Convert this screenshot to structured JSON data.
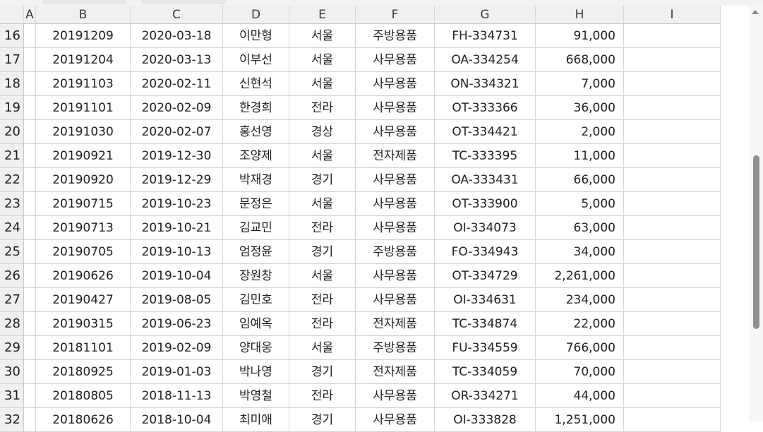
{
  "columns": [
    "A",
    "B",
    "C",
    "D",
    "E",
    "F",
    "G",
    "H",
    "I"
  ],
  "rows": [
    {
      "num": "16",
      "cells": [
        "",
        "20191209",
        "2020-03-18",
        "이만형",
        "서울",
        "주방용품",
        "FH-334731",
        "91,000",
        ""
      ]
    },
    {
      "num": "17",
      "cells": [
        "",
        "20191204",
        "2020-03-13",
        "이부선",
        "서울",
        "사무용품",
        "OA-334254",
        "668,000",
        ""
      ]
    },
    {
      "num": "18",
      "cells": [
        "",
        "20191103",
        "2020-02-11",
        "신현석",
        "서울",
        "사무용품",
        "ON-334321",
        "7,000",
        ""
      ]
    },
    {
      "num": "19",
      "cells": [
        "",
        "20191101",
        "2020-02-09",
        "한경희",
        "전라",
        "사무용품",
        "OT-333366",
        "36,000",
        ""
      ]
    },
    {
      "num": "20",
      "cells": [
        "",
        "20191030",
        "2020-02-07",
        "홍선영",
        "경상",
        "사무용품",
        "OT-334421",
        "2,000",
        ""
      ]
    },
    {
      "num": "21",
      "cells": [
        "",
        "20190921",
        "2019-12-30",
        "조양제",
        "서울",
        "전자제품",
        "TC-333395",
        "11,000",
        ""
      ]
    },
    {
      "num": "22",
      "cells": [
        "",
        "20190920",
        "2019-12-29",
        "박재경",
        "경기",
        "사무용품",
        "OA-333431",
        "66,000",
        ""
      ]
    },
    {
      "num": "23",
      "cells": [
        "",
        "20190715",
        "2019-10-23",
        "문정은",
        "서울",
        "사무용품",
        "OT-333900",
        "5,000",
        ""
      ]
    },
    {
      "num": "24",
      "cells": [
        "",
        "20190713",
        "2019-10-21",
        "김교민",
        "전라",
        "사무용품",
        "OI-334073",
        "63,000",
        ""
      ]
    },
    {
      "num": "25",
      "cells": [
        "",
        "20190705",
        "2019-10-13",
        "엄정윤",
        "경기",
        "주방용품",
        "FO-334943",
        "34,000",
        ""
      ]
    },
    {
      "num": "26",
      "cells": [
        "",
        "20190626",
        "2019-10-04",
        "장원창",
        "서울",
        "사무용품",
        "OT-334729",
        "2,261,000",
        ""
      ]
    },
    {
      "num": "27",
      "cells": [
        "",
        "20190427",
        "2019-08-05",
        "김민호",
        "전라",
        "사무용품",
        "OI-334631",
        "234,000",
        ""
      ]
    },
    {
      "num": "28",
      "cells": [
        "",
        "20190315",
        "2019-06-23",
        "임예옥",
        "전라",
        "전자제품",
        "TC-334874",
        "22,000",
        ""
      ]
    },
    {
      "num": "29",
      "cells": [
        "",
        "20181101",
        "2019-02-09",
        "양대웅",
        "서울",
        "주방용품",
        "FU-334559",
        "766,000",
        ""
      ]
    },
    {
      "num": "30",
      "cells": [
        "",
        "20180925",
        "2019-01-03",
        "박나영",
        "경기",
        "전자제품",
        "TC-334059",
        "70,000",
        ""
      ]
    },
    {
      "num": "31",
      "cells": [
        "",
        "20180805",
        "2018-11-13",
        "박영철",
        "전라",
        "사무용품",
        "OR-334271",
        "44,000",
        ""
      ]
    },
    {
      "num": "32",
      "cells": [
        "",
        "20180626",
        "2018-10-04",
        "최미애",
        "경기",
        "사무용품",
        "OI-333828",
        "1,251,000",
        ""
      ]
    }
  ]
}
